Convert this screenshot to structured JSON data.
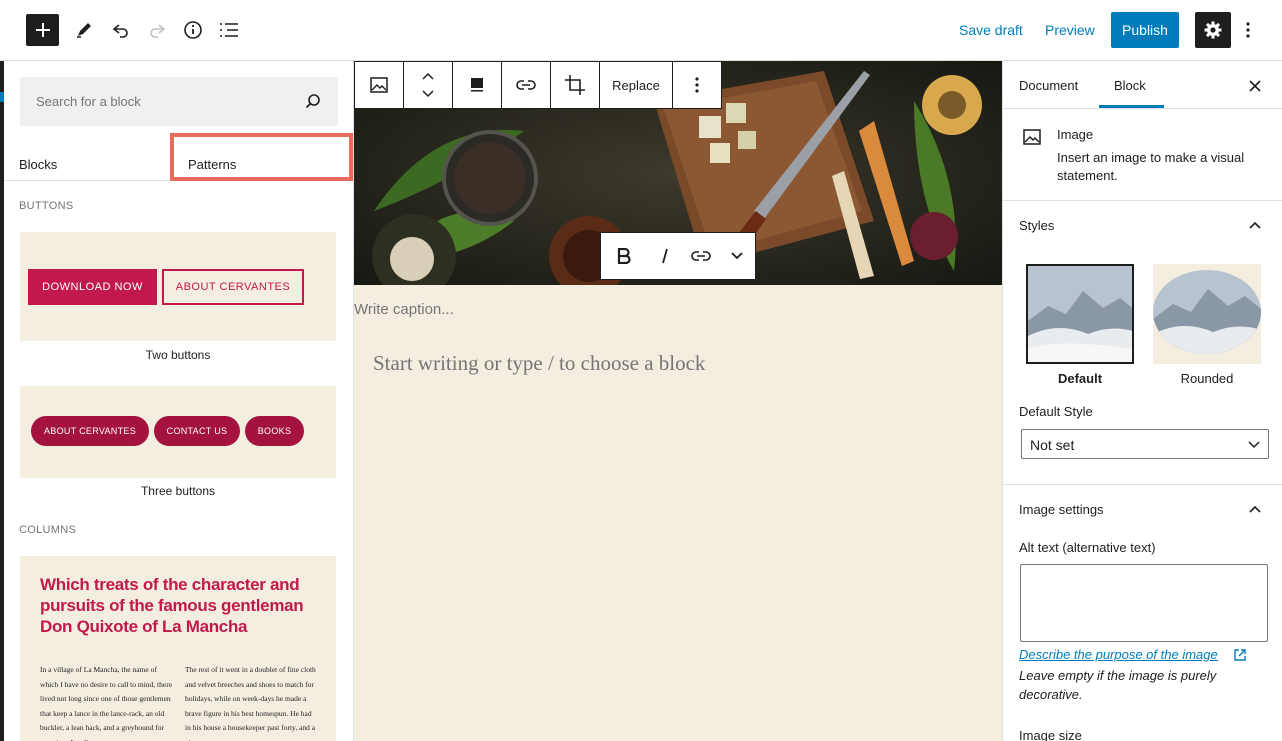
{
  "topbar": {
    "save_draft": "Save draft",
    "preview": "Preview",
    "publish": "Publish",
    "icons": [
      "plus-icon",
      "edit-pencil-icon",
      "undo-icon",
      "redo-icon",
      "info-icon",
      "list-view-icon",
      "gear-icon",
      "more-vertical-icon"
    ]
  },
  "inserter": {
    "search_placeholder": "Search for a block",
    "tabs": {
      "blocks": "Blocks",
      "patterns": "Patterns"
    },
    "active_tab": "Patterns",
    "highlight_color": "#ea6a5c",
    "categories": {
      "buttons": "BUTTONS",
      "columns": "COLUMNS"
    },
    "patterns": {
      "two_buttons": {
        "label": "Two buttons",
        "primary": "DOWNLOAD NOW",
        "secondary": "ABOUT CERVANTES"
      },
      "three_buttons": {
        "label": "Three buttons",
        "b1": "ABOUT CERVANTES",
        "b2": "CONTACT US",
        "b3": "BOOKS"
      },
      "columns": {
        "title": "Which treats of the character and pursuits of the famous gentleman Don Quixote of La Mancha",
        "col1": "In a village of La Mancha, the name of which I have no desire to call to mind, there lived not long since one of those gentlemen that keep a lance in the lance-rack, an old buckler, a lean hack, and a greyhound for coursing. An olla",
        "col2": "The rest of it went in a doublet of fine cloth and velvet breeches and shoes to match for holidays, while on week-days he made a brave figure in his best homespun. He had in his house a housekeeper past forty, and a niece"
      }
    }
  },
  "canvas": {
    "caption_placeholder": "Write caption...",
    "write_placeholder": "Start writing or type / to choose a block",
    "background": "#f4eee1",
    "block_toolbar": {
      "replace": "Replace",
      "icons": [
        "image-icon",
        "move-up-down-icon",
        "align-icon",
        "link-icon",
        "crop-icon",
        "more-vertical-icon"
      ]
    },
    "format_toolbar": {
      "icons": [
        "bold-icon",
        "italic-icon",
        "link-icon",
        "chevron-down-icon"
      ]
    }
  },
  "settings": {
    "tabs": {
      "document": "Document",
      "block": "Block"
    },
    "active_tab": "Block",
    "block_card": {
      "title": "Image",
      "description": "Insert an image to make a visual statement."
    },
    "styles": {
      "title": "Styles",
      "options": [
        "Default",
        "Rounded"
      ],
      "selected": "Default",
      "default_style_label": "Default Style",
      "default_style_value": "Not set"
    },
    "image_settings": {
      "title": "Image settings",
      "alt_label": "Alt text (alternative text)",
      "alt_value": "",
      "help_link": "Describe the purpose of the image",
      "help_text": "Leave empty if the image is purely decorative.",
      "image_size_label": "Image size"
    },
    "accent": "#007cba"
  }
}
